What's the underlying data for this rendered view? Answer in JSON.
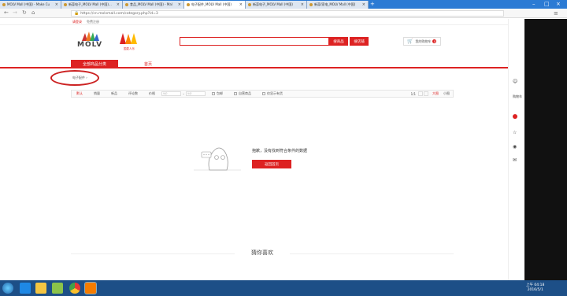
{
  "browser": {
    "tabs": [
      {
        "title": "MOLV Mall (中国) - Make Cu"
      },
      {
        "title": "新蒜电子_MOLV Mall (中国)..."
      },
      {
        "title": "食品_MOLV Mall (中国) - Mal"
      },
      {
        "title": "电子配件_MOLV Mall (中国)",
        "active": true
      },
      {
        "title": "新蒜电子_MOLV Mall (中国)"
      },
      {
        "title": "新蒜/家电_MOLV Mall (中国)"
      }
    ],
    "url": "https://cn.molvmall.com/category.php?id=3"
  },
  "site": {
    "topstrip_left": "请登录",
    "topstrip_right": "免费注册",
    "logo_text": "MOLV",
    "logo2_text": "国麦人乐",
    "search_btn": "搜商品",
    "search_btn2": "搜店铺",
    "cart_label": "我的购物车",
    "cart_count": "0",
    "category_tab": "全部商品分类",
    "home_link": "首页",
    "breadcrumb": "电子配件 ›"
  },
  "filters": {
    "items": [
      "默认",
      "销量",
      "新品",
      "评论数",
      "价格"
    ],
    "price_from": "¥价",
    "price_to": "¥价",
    "checks": [
      "包邮",
      "自营商品",
      "仅显示有货"
    ],
    "page_info": "1/1",
    "view_big": "大图",
    "view_list": "小图"
  },
  "empty": {
    "message": "抱歉，没有找到符合条件的数据",
    "back_button": "返回首页"
  },
  "guess": "猜你喜欢",
  "sidebar": [
    "我的",
    "购物车",
    "收藏",
    "足迹",
    "消息"
  ],
  "taskbar": {
    "time": "上午 04:18",
    "date": "2016/5/1"
  },
  "colors": {
    "brand": "#dd2222",
    "chrome": "#2b7bd4",
    "taskbar": "#1d4f87"
  }
}
